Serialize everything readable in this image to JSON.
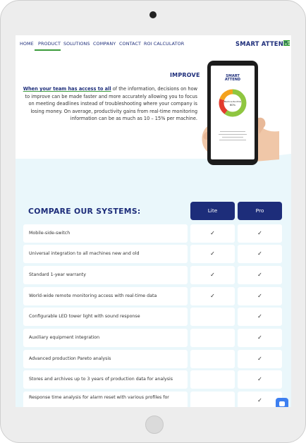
{
  "nav": {
    "items": [
      "HOME",
      "PRODUCT",
      "SOLUTIONS",
      "COMPANY",
      "CONTACT",
      "ROI CALCULATOR"
    ],
    "active": "PRODUCT",
    "logo": "SMART ATTEND"
  },
  "hero": {
    "heading": "IMPROVE",
    "highlight": "When your team has access to all",
    "text": " of the information, decisions on how to improve can be made faster and more accurately allowing you to focus on meeting deadlines instead of troubleshooting where your company is losing money. On average, productivity gains from real-time monitoring information can be as much as 10 – 15% per machine.",
    "device_logo_line1": "SMART",
    "device_logo_line2": "ATTEND",
    "device_chart_label": "Machine Runtime",
    "device_chart_value": "60%"
  },
  "compare": {
    "title": "COMPARE OUR SYSTEMS:",
    "columns": [
      "Lite",
      "Pro"
    ],
    "rows": [
      {
        "feature": "Mobile-side-switch",
        "lite": "✓",
        "pro": "✓"
      },
      {
        "feature": "Universal integration to all machines new and old",
        "lite": "✓",
        "pro": "✓"
      },
      {
        "feature": "Standard 1-year warranty",
        "lite": "✓",
        "pro": "✓"
      },
      {
        "feature": "World-wide remote monitoring access with real-time data",
        "lite": "✓",
        "pro": "✓"
      },
      {
        "feature": "Configurable LED tower light with sound response",
        "lite": "",
        "pro": "✓"
      },
      {
        "feature": "Auxiliary equipment integration",
        "lite": "",
        "pro": "✓"
      },
      {
        "feature": "Advanced production Pareto analysis",
        "lite": "",
        "pro": "✓"
      },
      {
        "feature": "Stores and archives up to 3 years of production data for analysis",
        "lite": "",
        "pro": "✓"
      },
      {
        "feature": "Response time analysis for alarm reset with various profiles for",
        "lite": "",
        "pro": "✓"
      }
    ]
  },
  "colors": {
    "brand_navy": "#1d2d7a",
    "brand_green": "#3b9b3b",
    "chat_blue": "#3d7ff0"
  },
  "icons": {
    "chat": "chat-bubble-icon",
    "check": "checkmark"
  }
}
